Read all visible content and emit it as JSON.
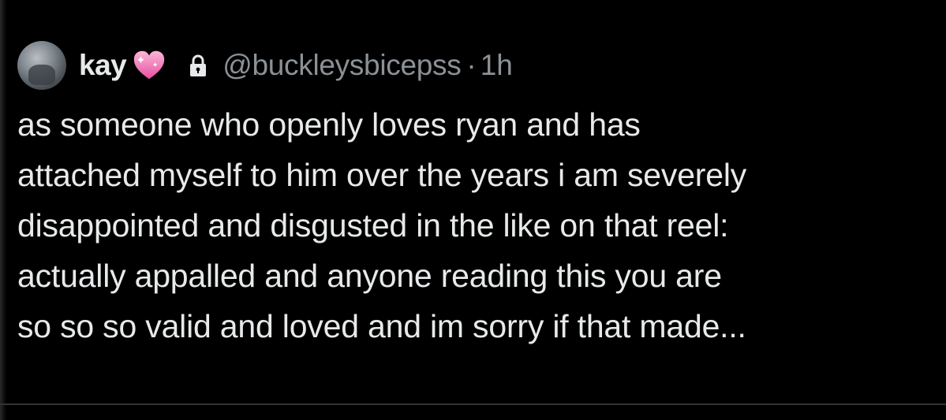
{
  "tweet": {
    "display_name": "kay",
    "name_emoji": "💗",
    "handle": "@buckleysbicepss",
    "separator": "·",
    "time": "1h",
    "icons": {
      "avatar": "user-avatar",
      "emoji": "sparkling-heart-icon",
      "protected": "lock-icon"
    },
    "text_lines": [
      "as someone who openly loves ryan and has",
      "attached myself to him over the years i am severely",
      "disappointed and disgusted in the like on that reel:",
      "actually appalled and anyone reading this you are",
      "so so so valid and loved and im sorry if that made..."
    ]
  },
  "colors": {
    "background": "#000000",
    "primary_text": "#e7e9ea",
    "secondary_text": "#8b9196",
    "heart_pink": "#f472b6"
  }
}
